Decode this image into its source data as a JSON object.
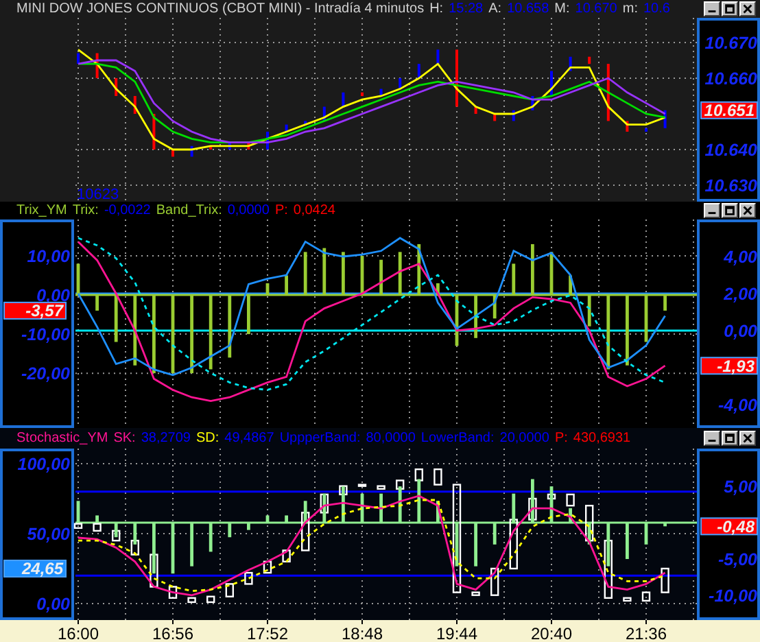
{
  "panels": [
    {
      "kind": "price",
      "header": [
        {
          "text": "MINI DOW JONES CONTINUOS (CBOT MINI) - Intradía 4 minutos",
          "color": "#d0d0d0"
        },
        {
          "text": "H:",
          "color": "#d0d0d0"
        },
        {
          "text": "15:28",
          "color": "#0000ff"
        },
        {
          "text": "A:",
          "color": "#d0d0d0"
        },
        {
          "text": "10.658",
          "color": "#0000ff"
        },
        {
          "text": "M:",
          "color": "#d0d0d0"
        },
        {
          "text": "10.670",
          "color": "#0000ff"
        },
        {
          "text": "m:",
          "color": "#d0d0d0"
        },
        {
          "text": "10.6",
          "color": "#0000ff"
        }
      ],
      "corner_label": "10623",
      "markers": [
        {
          "kind": "right_axis",
          "text": "10.651",
          "color": "#ff0000"
        }
      ],
      "chart_data": {
        "type": "line",
        "grid": true,
        "stacked": false,
        "ylim": [
          10625.4,
          10676.9
        ],
        "yticks": [
          {
            "value": 10670,
            "label": "10.670"
          },
          {
            "value": 10660,
            "label": "10.660"
          },
          {
            "value": 10640,
            "label": "10.640"
          },
          {
            "value": 10630,
            "label": "10.630"
          }
        ],
        "series": [
          {
            "type": "bar",
            "color": "#0000ff",
            "values": [
              3,
              null,
              null,
              null,
              null,
              null,
              3,
              null,
              2,
              null,
              5,
              2,
              1,
              4,
              4,
              null,
              2,
              3,
              4,
              4,
              null,
              null,
              null,
              3,
              4,
              7,
              4,
              null,
              null,
              null,
              1,
              5
            ],
            "base": [
              10664,
              null,
              null,
              null,
              null,
              null,
              10638,
              null,
              10640,
              null,
              10640,
              10645,
              10647,
              10648,
              10652,
              null,
              10655,
              10657,
              10660,
              10664,
              null,
              null,
              null,
              10648,
              10651,
              10655,
              10662,
              null,
              null,
              null,
              10645,
              10646
            ]
          },
          {
            "type": "bar",
            "color": "#ff0000",
            "values": [
              null,
              7,
              5,
              5,
              10,
              2,
              null,
              1,
              null,
              2,
              null,
              null,
              null,
              null,
              null,
              1,
              null,
              null,
              null,
              null,
              16,
              2,
              2,
              null,
              null,
              null,
              null,
              2,
              16,
              3,
              null,
              null
            ],
            "base": [
              null,
              10660,
              10655,
              10650,
              10640,
              10638,
              null,
              10640,
              null,
              10640,
              null,
              null,
              null,
              null,
              null,
              10655,
              null,
              null,
              null,
              null,
              10652,
              10650,
              10648,
              null,
              null,
              null,
              null,
              10664,
              10648,
              10645,
              null,
              null
            ]
          },
          {
            "type": "line",
            "color": "#ffff00",
            "values": [
              10668,
              10664,
              10657,
              10652,
              10643,
              10640,
              10640,
              10641,
              10641,
              10641,
              10643,
              10645,
              10647,
              10649,
              10652,
              10654,
              10655,
              10657,
              10660,
              10664,
              10657,
              10652,
              10650,
              10650,
              10652,
              10657,
              10663,
              10663,
              10652,
              10647,
              10647,
              10649
            ]
          },
          {
            "type": "line",
            "color": "#00dd00",
            "values": [
              10664,
              10664,
              10663,
              10659,
              10649,
              10645,
              10643,
              10642,
              10642,
              10642,
              10643,
              10644,
              10646,
              10648,
              10650,
              10652,
              10654,
              10656,
              10658,
              10659,
              10658,
              10657,
              10656,
              10655,
              10654,
              10655,
              10657,
              10659,
              10656,
              10653,
              10650,
              10649
            ]
          },
          {
            "type": "line",
            "color": "#9933ff",
            "values": [
              10664,
              10665,
              10665,
              10662,
              10653,
              10648,
              10645,
              10643,
              10642,
              10642,
              10642,
              10643,
              10645,
              10646,
              10648,
              10650,
              10652,
              10654,
              10656,
              10658,
              10659,
              10658,
              10657,
              10656,
              10654,
              10654,
              10656,
              10658,
              10660,
              10656,
              10653,
              10650
            ]
          }
        ]
      }
    },
    {
      "kind": "trix",
      "header": [
        {
          "text": "Trix_YM",
          "color": "#9acd32"
        },
        {
          "text": "Trix:",
          "color": "#9acd32"
        },
        {
          "text": "-0,0022",
          "color": "#0000ff"
        },
        {
          "text": "Band_Trix:",
          "color": "#9acd32"
        },
        {
          "text": "0,0000",
          "color": "#0000ff"
        },
        {
          "text": "P:",
          "color": "#ff0000"
        },
        {
          "text": "0,0424",
          "color": "#ff0000"
        }
      ],
      "markers": [
        {
          "kind": "left_axis",
          "text": "-3,57",
          "color": "#ff0000"
        },
        {
          "kind": "right_axis",
          "text": "-1,93",
          "color": "#ff0000"
        }
      ],
      "chart_data": {
        "type": "line",
        "grid": true,
        "ylim": [
          -34.0,
          19.3
        ],
        "y2lim": [
          -5.26,
          6.0
        ],
        "yticks": [
          {
            "value": 10,
            "label": "10,00"
          },
          {
            "value": 0,
            "label": "0,00"
          },
          {
            "value": -10,
            "label": "-10,00"
          },
          {
            "value": -20,
            "label": "-20,00"
          }
        ],
        "y2ticks": [
          {
            "value": 4,
            "label": "4,00"
          },
          {
            "value": 2,
            "label": "2,00"
          },
          {
            "value": 0,
            "label": "0,00"
          },
          {
            "value": -4,
            "label": "-4,00"
          }
        ],
        "ref_lines": [
          {
            "axis": "y2",
            "value": 2,
            "color": "#1e90ff"
          },
          {
            "axis": "y2",
            "value": 0,
            "color": "#00e5ee"
          },
          {
            "axis": "y",
            "value": 0,
            "color": "#9acd32"
          }
        ],
        "series": [
          {
            "type": "bar",
            "color": "#9acd32",
            "values": [
              8,
              -4,
              -12,
              -18,
              -20,
              -20,
              -20,
              -19,
              -16,
              -10,
              3,
              5,
              11,
              12,
              11,
              10,
              9,
              11,
              13,
              3,
              -13,
              -11,
              -6,
              8,
              13,
              11,
              5,
              -8,
              -19,
              -18,
              -12,
              -4
            ]
          },
          {
            "type": "line",
            "axis": "y2",
            "color": "#ff1493",
            "values": [
              4.8,
              3.8,
              2.0,
              0.0,
              -2.6,
              -3.2,
              -3.6,
              -3.8,
              -3.6,
              -3.2,
              -2.8,
              -2.5,
              0.5,
              1.2,
              1.6,
              2.0,
              2.6,
              3.2,
              3.6,
              2.0,
              0.0,
              0.1,
              0.3,
              1.2,
              1.8,
              1.7,
              1.5,
              0.0,
              -2.5,
              -3.0,
              -2.6,
              -1.9
            ]
          },
          {
            "type": "line",
            "axis": "y2",
            "color": "#1e90ff",
            "values": [
              2.0,
              0.2,
              -1.8,
              -1.5,
              -2.1,
              -2.4,
              -2.0,
              -1.4,
              -0.8,
              2.5,
              2.8,
              3.0,
              4.8,
              4.2,
              4.0,
              4.1,
              4.3,
              5.0,
              4.4,
              1.5,
              0.1,
              0.8,
              1.5,
              4.3,
              3.8,
              4.2,
              3.0,
              -0.5,
              -2.0,
              -1.6,
              -0.8,
              0.8
            ]
          },
          {
            "type": "line",
            "axis": "y2",
            "line_style": "dashed",
            "color": "#00e5ee",
            "values": [
              5.0,
              4.6,
              3.9,
              2.6,
              0.2,
              -0.8,
              -1.6,
              -2.3,
              -2.8,
              -3.1,
              -3.2,
              -2.9,
              -1.7,
              -1.1,
              -0.4,
              0.3,
              1.0,
              1.7,
              2.4,
              3.0,
              1.6,
              0.8,
              0.3,
              0.5,
              1.1,
              1.6,
              1.9,
              1.2,
              -0.8,
              -1.7,
              -2.4,
              -2.8
            ]
          }
        ]
      }
    },
    {
      "kind": "stochastic",
      "header": [
        {
          "text": "Stochastic_YM",
          "color": "#ff1493"
        },
        {
          "text": "SK:",
          "color": "#ff1493"
        },
        {
          "text": "38,2709",
          "color": "#0000ff"
        },
        {
          "text": "SD:",
          "color": "#ffff00"
        },
        {
          "text": "49,4867",
          "color": "#0000ff"
        },
        {
          "text": "UppperBand:",
          "color": "#0000ff"
        },
        {
          "text": "80,0000",
          "color": "#0000ff"
        },
        {
          "text": "LowerBand:",
          "color": "#0000ff"
        },
        {
          "text": "20,0000",
          "color": "#0000ff"
        },
        {
          "text": "P:",
          "color": "#ff0000"
        },
        {
          "text": "430,6931",
          "color": "#ff0000"
        }
      ],
      "markers": [
        {
          "kind": "left_axis",
          "text": "24,65",
          "color": "#1e90ff"
        },
        {
          "kind": "right_axis",
          "text": "-0,48",
          "color": "#ff0000"
        }
      ],
      "chart_data": {
        "type": "line",
        "grid": true,
        "categories": [
          "16:00",
          null,
          null,
          null,
          null,
          "16:56",
          null,
          null,
          null,
          null,
          "17:52",
          null,
          null,
          null,
          null,
          "18:48",
          null,
          null,
          null,
          null,
          "19:44",
          null,
          null,
          null,
          null,
          "20:40",
          null,
          null,
          null,
          null,
          "21:36",
          null
        ],
        "ylim": [
          -11.8,
          110.8
        ],
        "y2lim": [
          -13.4,
          10.2
        ],
        "yticks": [
          {
            "value": 100,
            "label": "100,00"
          },
          {
            "value": 50,
            "label": "50,00"
          },
          {
            "value": 0,
            "label": "0,00"
          }
        ],
        "y2ticks": [
          {
            "value": 5,
            "label": "5,00"
          },
          {
            "value": -5,
            "label": "-5,00"
          },
          {
            "value": -10,
            "label": "-10,00"
          }
        ],
        "ref_lines": [
          {
            "axis": "y",
            "value": 80,
            "color": "#0000ff"
          },
          {
            "axis": "y",
            "value": 20,
            "color": "#0000ff"
          },
          {
            "axis": "y2",
            "value": 0,
            "color": "#90ee90"
          }
        ],
        "series": [
          {
            "type": "bar",
            "color": "#ffffff",
            "values": [
              3,
              5,
              7,
              10,
              23,
              8,
              3,
              4,
              9,
              8,
              8,
              8,
              27,
              13,
              6,
              1,
              2,
              6,
              8,
              11,
              77,
              2,
              19,
              35,
              15,
              3,
              8,
              25,
              41,
              2,
              6,
              17
            ],
            "base": [
              54,
              52,
              45,
              35,
              12,
              4,
              1,
              1,
              5,
              14,
              22,
              30,
              38,
              65,
              78,
              84,
              82,
              82,
              88,
              85,
              8,
              6,
              6,
              25,
              60,
              75,
              70,
              45,
              4,
              2,
              2,
              8
            ]
          },
          {
            "type": "bar",
            "axis": "y2",
            "color": "#90ee90",
            "values": [
              3,
              1,
              -2,
              -3,
              -7,
              -7,
              -6,
              -4,
              -2,
              -1,
              1,
              1,
              3,
              4,
              5,
              4,
              4,
              5,
              6,
              3,
              -6,
              -6,
              -3,
              4,
              6,
              5,
              2,
              -3,
              -6,
              -5,
              -3,
              -0.5
            ]
          },
          {
            "type": "line",
            "color": "#ff1493",
            "values": [
              47,
              46,
              40,
              30,
              12,
              8,
              6,
              10,
              17,
              24,
              30,
              37,
              58,
              70,
              72,
              70,
              68,
              73,
              77,
              70,
              14,
              10,
              22,
              52,
              68,
              68,
              62,
              44,
              12,
              10,
              14,
              22
            ]
          },
          {
            "type": "line",
            "line_style": "dashed",
            "color": "#ffff00",
            "values": [
              45,
              45,
              42,
              36,
              18,
              12,
              9,
              10,
              13,
              18,
              24,
              30,
              47,
              57,
              64,
              68,
              69,
              70,
              74,
              74,
              30,
              18,
              18,
              35,
              55,
              62,
              64,
              55,
              22,
              16,
              16,
              20
            ]
          }
        ]
      }
    }
  ]
}
